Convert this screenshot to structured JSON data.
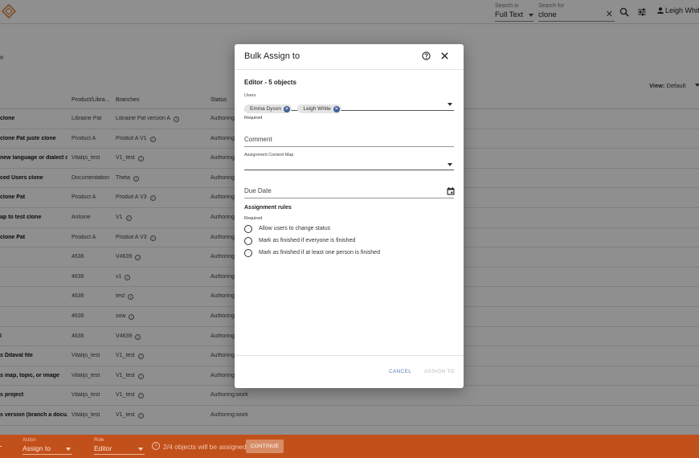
{
  "header": {
    "search_in_label": "Search in",
    "search_in_value": "Full Text",
    "search_for_label": "Search for",
    "search_for_value": "clone",
    "user_name": "Leigh White"
  },
  "page": {
    "breadcrumb": "e",
    "view_label": "View:",
    "view_value": "Default"
  },
  "table": {
    "columns": [
      "Product/Libra...",
      "Branches",
      "Status"
    ],
    "rows": [
      {
        "name": "clone",
        "product": "Librairie Pat",
        "branch": "Librairie Pat version A",
        "status": "Authoring:"
      },
      {
        "name": "clone Pat juste clone",
        "product": "Product A",
        "branch": "Produit A V1",
        "status": "Authoring:"
      },
      {
        "name": "new language or dialect d...",
        "product": "Vitalijs_test",
        "branch": "V1_test",
        "status": "Authoring:"
      },
      {
        "name": "ced Users clone",
        "product": "Documentation",
        "branch": "Theta",
        "status": "Authoring:"
      },
      {
        "name": "clone Pat",
        "product": "Product A",
        "branch": "Produit A V3",
        "status": "Authoring:"
      },
      {
        "name": "ap to test clone",
        "product": "Antoine",
        "branch": "V1",
        "status": "Authoring:"
      },
      {
        "name": "clone Pat",
        "product": "Product A",
        "branch": "Produit A V3",
        "status": "Authoring:"
      },
      {
        "name": "",
        "product": "4636",
        "branch": "V4639",
        "status": "Authoring:"
      },
      {
        "name": "",
        "product": "4636",
        "branch": "v1",
        "status": "Authoring:"
      },
      {
        "name": "",
        "product": "4636",
        "branch": "test",
        "status": "Authoring:"
      },
      {
        "name": "",
        "product": "4636",
        "branch": "sow",
        "status": "Authoring:"
      },
      {
        "name": "l",
        "product": "4636",
        "branch": "V4639",
        "status": "Authoring:"
      },
      {
        "name": "s Ditaval file",
        "product": "Vitalijs_test",
        "branch": "V1_test",
        "status": "Authoring:"
      },
      {
        "name": "s map, topic, or image",
        "product": "Vitalijs_test",
        "branch": "V1_test",
        "status": "Authoring:"
      },
      {
        "name": "s project",
        "product": "Vitalijs_test",
        "branch": "V1_test",
        "status": "Authoring:work"
      },
      {
        "name": "s version (branch a docu...",
        "product": "Vitalijs_test",
        "branch": "V1_test",
        "status": "Authoring:work"
      }
    ]
  },
  "modal": {
    "title": "Bulk Assign to",
    "section_title": "Editor - 5 objects",
    "users_label": "Users",
    "users": [
      "Emma Dyson",
      "Leigh White"
    ],
    "users_required": "Required",
    "comment_placeholder": "Comment",
    "context_map_label": "Assignment Context Map",
    "due_date_placeholder": "Due Date",
    "rules_title": "Assignment rules",
    "rules_required": "Required",
    "rules": [
      "Allow users to change status",
      "Mark as finished if everyone is finished",
      "Mark as finished if at least one person is finished"
    ],
    "cancel_label": "CANCEL",
    "assign_label": "ASSIGN TO"
  },
  "action_bar": {
    "action_label": "Action",
    "action_value": "Assign to",
    "role_label": "Role",
    "role_value": "Editor",
    "info_text": "2/4 objects will be assigned",
    "continue_label": "CONTINUE"
  },
  "colors": {
    "action_bar": "#c2501b",
    "chip_remove": "#3e5e96",
    "link_button": "#5c7fb8",
    "logo": "#e08a3c"
  },
  "icons": [
    "logo-icon",
    "search-icon",
    "filter-settings-icon",
    "person-icon",
    "help-icon",
    "close-icon",
    "calendar-icon",
    "info-icon",
    "chip-remove-icon"
  ]
}
